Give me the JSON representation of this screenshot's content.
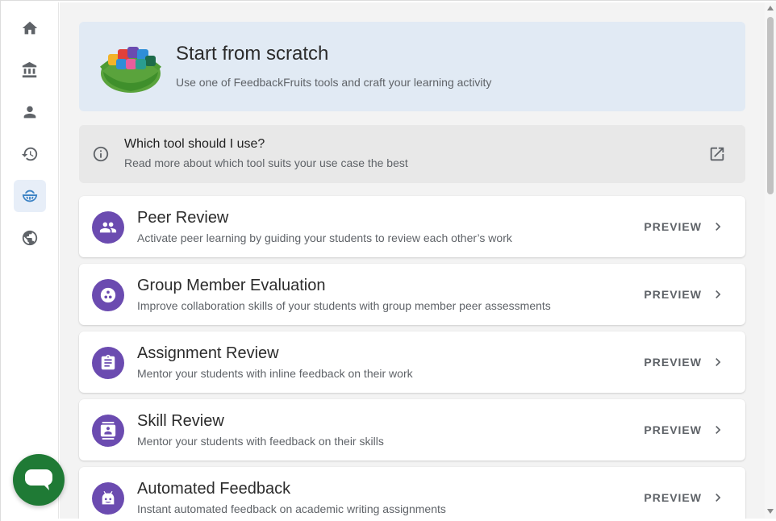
{
  "nav": {
    "items": [
      {
        "id": "home",
        "icon": "home-icon",
        "active": false
      },
      {
        "id": "institution",
        "icon": "institution-icon",
        "active": false
      },
      {
        "id": "profile",
        "icon": "person-icon",
        "active": false
      },
      {
        "id": "history",
        "icon": "history-icon",
        "active": false
      },
      {
        "id": "tools",
        "icon": "fruit-basket-icon",
        "active": true
      },
      {
        "id": "public",
        "icon": "globe-icon",
        "active": false
      }
    ]
  },
  "hero": {
    "title": "Start from scratch",
    "subtitle": "Use one of FeedbackFruits tools and craft your learning activity"
  },
  "info": {
    "title": "Which tool should I use?",
    "subtitle": "Read more about which tool suits your use case the best"
  },
  "tools": [
    {
      "title": "Peer Review",
      "subtitle": "Activate peer learning by guiding your students to review each other’s work",
      "icon": "people-icon",
      "action": "PREVIEW"
    },
    {
      "title": "Group Member Evaluation",
      "subtitle": "Improve collaboration skills of your students with group member peer assessments",
      "icon": "group-circle-icon",
      "action": "PREVIEW"
    },
    {
      "title": "Assignment Review",
      "subtitle": "Mentor your students with inline feedback on their work",
      "icon": "clipboard-icon",
      "action": "PREVIEW"
    },
    {
      "title": "Skill Review",
      "subtitle": "Mentor your students with feedback on their skills",
      "icon": "contact-card-icon",
      "action": "PREVIEW"
    },
    {
      "title": "Automated Feedback",
      "subtitle": "Instant automated feedback on academic writing assignments",
      "icon": "robot-icon",
      "action": "PREVIEW"
    }
  ],
  "colors": {
    "accent": "#3b82c4",
    "tool_icon_bg": "#6b4bb0",
    "hero_bg": "#e1eaf4",
    "chat_fab": "#1f7a35"
  }
}
